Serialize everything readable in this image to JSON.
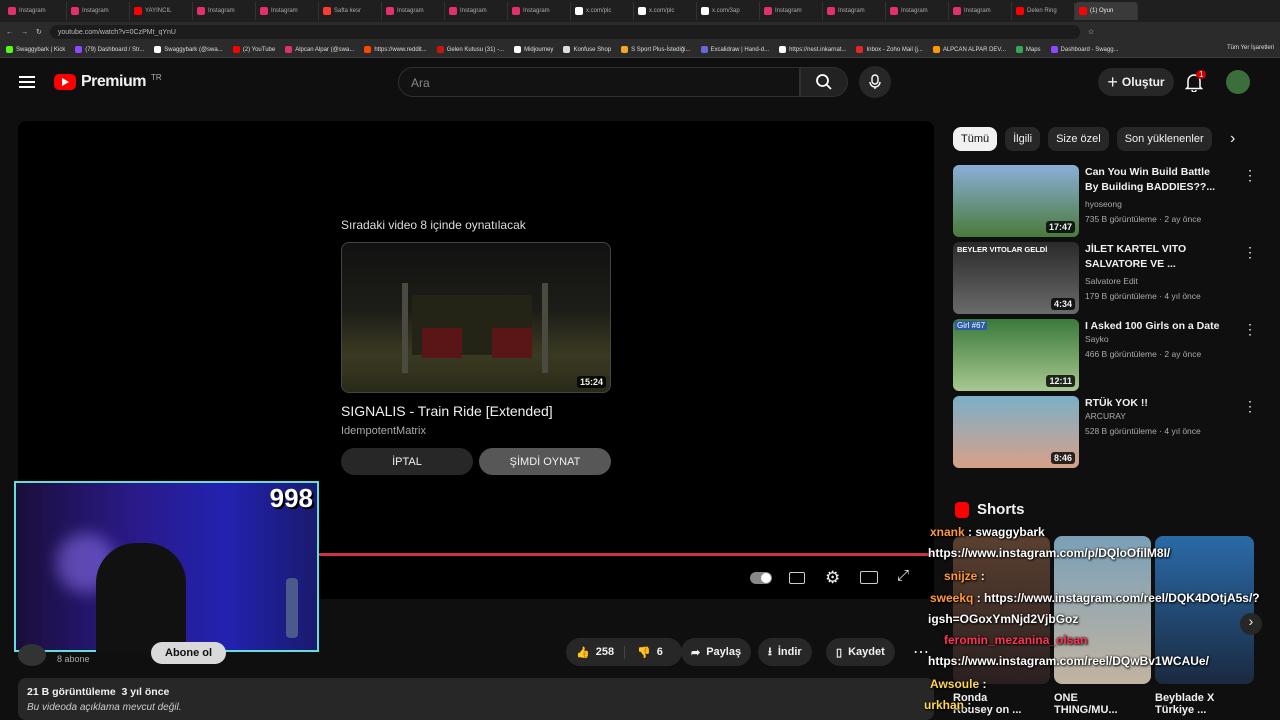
{
  "browser": {
    "tabs": [
      "Instagram",
      "Instagram",
      "YAYINCIL",
      "Instagram",
      "Instagram",
      "Safta kesr",
      "Instagram",
      "Instagram",
      "Instagram",
      "x.com/plc",
      "x.com/plc",
      "x.com/3ap",
      "Instagram",
      "Instagram",
      "Instagram",
      "Instagram",
      "Delen Ring",
      "(1) Oyun"
    ],
    "url": "youtube.com/watch?v=0CzPMt_qYnU",
    "bookmarks": [
      "Swaggybark | Kick",
      "(79) Dashboard / Str...",
      "Swaggybark (@swa...",
      "(2) YouTube",
      "Alpcan Alpar (@swa...",
      "https://www.reddit...",
      "Gelen Kutusu (31) -...",
      "Midjourney",
      "Konfuse Shop",
      "S Sport Plus-İstediği...",
      "Excalidraw | Hand-d...",
      "https://nest.inkarnat...",
      "Inbox - Zoho Mail (j...",
      "ALPCAN ALPAR DEV...",
      "Maps",
      "Dashboard - Swagg..."
    ],
    "bookmarks_right": "Tüm Yer İşaretleri"
  },
  "header": {
    "logo": "Premium",
    "region": "TR",
    "search_placeholder": "Ara",
    "create_label": "Oluştur",
    "notif_count": "1"
  },
  "player": {
    "upnext_label": "Sıradaki video 8 içinde oynatılacak",
    "next_duration": "15:24",
    "next_title": "SIGNALIS - Train Ride [Extended]",
    "next_channel": "IdempotentMatrix",
    "cancel_label": "İPTAL",
    "play_now_label": "ŞİMDİ OYNAT",
    "progress": 1.0
  },
  "webcam": {
    "counter": "998"
  },
  "below": {
    "subscribers": "8 abone",
    "subscribe_label": "Abone ol",
    "likes": "258",
    "dislikes": "6",
    "share_label": "Paylaş",
    "download_label": "İndir",
    "save_label": "Kaydet",
    "views": "21 B görüntüleme",
    "age": "3 yıl önce",
    "description": "Bu videoda açıklama mevcut değil."
  },
  "chips": [
    "Tümü",
    "İlgili",
    "Size özel",
    "Son yüklenenler"
  ],
  "recommendations": [
    {
      "title": "Can You Win Build Battle By Building BADDIES??...",
      "channel": "hyoseong",
      "meta": "735 B görüntüleme · 2 ay önce",
      "duration": "17:47"
    },
    {
      "title": "JİLET KARTEL VITO SALVATORE VE ...",
      "channel": "Salvatore Edit",
      "meta": "179 B görüntüleme · 4 yıl önce",
      "duration": "4:34"
    },
    {
      "title": "I Asked 100 Girls on a Date",
      "channel": "Sayko",
      "meta": "466 B görüntüleme · 2 ay önce",
      "duration": "12:11"
    },
    {
      "title": "RTÜk YOK !!",
      "channel": "ARCURAY",
      "meta": "528 B görüntüleme · 4 yıl önce",
      "duration": "8:46"
    }
  ],
  "thumb_labels": [
    "BEYLER VITOLAR GELDİ",
    "Girl #67"
  ],
  "shorts": {
    "title": "Shorts",
    "items": [
      "Ronda Rousey on ...",
      "ONE THING/MU...",
      "Beyblade X Türkiye ..."
    ]
  },
  "chat": [
    {
      "user": "xnank",
      "text": ": swaggybark"
    },
    {
      "user": "",
      "text": "https://www.instagram.com/p/DQloOfilM8I/"
    },
    {
      "user": "snijze",
      "text": ":"
    },
    {
      "user": "sweekq",
      "text": ": https://www.instagram.com/reel/DQK4DOtjA5s/?"
    },
    {
      "user": "",
      "text": "igsh=OGoxYmNjd2VjbGoz"
    },
    {
      "user": "feromin_mezanina_olsan",
      "text": ""
    },
    {
      "user": "",
      "text": "https://www.instagram.com/reel/DQwBv1WCAUe/"
    },
    {
      "user": "Awsoule",
      "text": ":"
    },
    {
      "user": "urkhan",
      "text": ":"
    }
  ],
  "colors": {
    "accent": "#ff0000",
    "bg": "#0f0f0f"
  }
}
